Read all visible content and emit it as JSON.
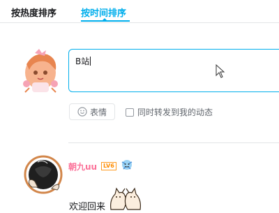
{
  "tabs": {
    "hot": "按热度排序",
    "time": "按时间排序",
    "active": "time"
  },
  "reply": {
    "input_value": "B站"
  },
  "toolbar": {
    "emoji_label": "表情",
    "repost_label": "同时转发到我的动态"
  },
  "comment": {
    "username": "朝九uu",
    "level_badge": "LV6",
    "text": "欢迎回来"
  },
  "colors": {
    "accent": "#00aeec",
    "username": "#fb7299",
    "level": "#ff8c00"
  },
  "icons": {
    "emoji": "smile-face-icon",
    "cursor": "mouse-pointer-icon",
    "medal": "fan-medal-icon"
  }
}
